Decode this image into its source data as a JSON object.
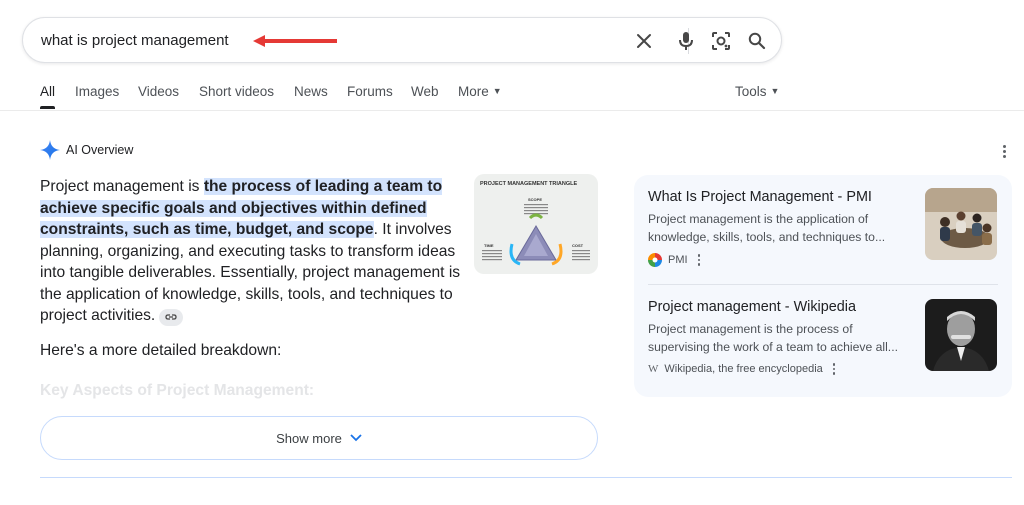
{
  "search": {
    "query": "what is project management"
  },
  "tabs": [
    {
      "label": "All",
      "active": true
    },
    {
      "label": "Images"
    },
    {
      "label": "Videos"
    },
    {
      "label": "Short videos"
    },
    {
      "label": "News"
    },
    {
      "label": "Forums"
    },
    {
      "label": "Web"
    },
    {
      "label": "More"
    }
  ],
  "tools_label": "Tools",
  "ai_overview": {
    "title": "AI Overview",
    "text_start": "Project management is ",
    "text_highlight": "the process of leading a team to achieve specific goals and objectives within defined constraints, such as time, budget, and scope",
    "text_end": ". It involves planning, organizing, and executing tasks to transform ideas into tangible deliverables. Essentially, project management is the application of knowledge, skills, tools, and techniques to project activities.",
    "breakdown": "Here's a more detailed breakdown:",
    "faded_heading": "Key Aspects of Project Management:",
    "show_more": "Show more",
    "thumbnail": {
      "title": "PROJECT MANAGEMENT TRIANGLE",
      "scope": "SCOPE",
      "time": "TIME",
      "cost": "COST"
    }
  },
  "sources": [
    {
      "title": "What Is Project Management - PMI",
      "snippet_line1": "Project management is the application of",
      "snippet_line2": "knowledge, skills, tools, and techniques to...",
      "site": "PMI",
      "icon": "pmi-logo-icon"
    },
    {
      "title": "Project management - Wikipedia",
      "snippet_line1": "Project management is the process of",
      "snippet_line2": "supervising the work of a team to achieve all...",
      "site": "Wikipedia, the free encyclopedia",
      "icon": "wikipedia-logo-icon"
    }
  ],
  "colors": {
    "accent_blue": "#1a73e8",
    "highlight": "#d3e3fd",
    "arrow_red": "#e53935",
    "card_bg": "#f5f8fd"
  }
}
